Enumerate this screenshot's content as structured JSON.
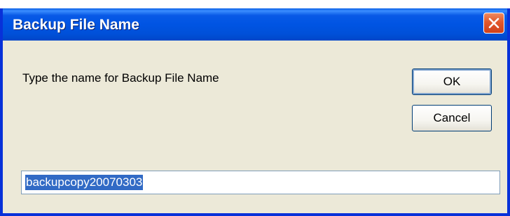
{
  "dialog": {
    "title": "Backup File Name",
    "prompt": "Type the name for Backup File Name",
    "ok_label": "OK",
    "cancel_label": "Cancel",
    "input_value": "backupcopy20070303"
  },
  "icons": {
    "close": "close-icon"
  },
  "colors": {
    "titlebar": "#0054e3",
    "client_background": "#ece9d8",
    "close_button": "#e2572b",
    "selection": "#316ac5"
  }
}
